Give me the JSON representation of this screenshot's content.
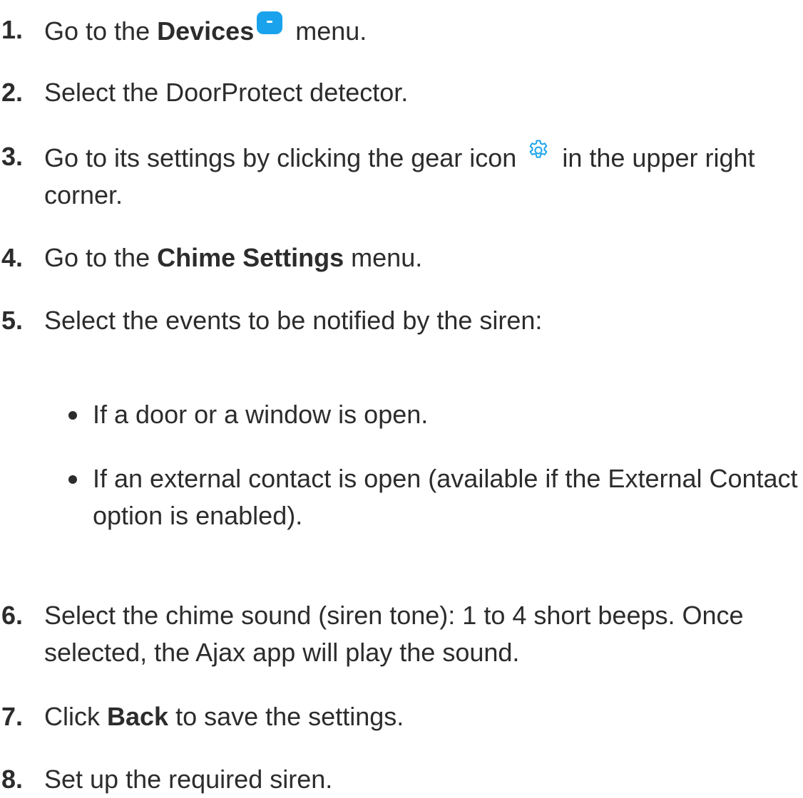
{
  "steps": [
    {
      "num": "1.",
      "pre": "Go to the ",
      "bold": "Devices",
      "post": " menu.",
      "icon": "devices-icon"
    },
    {
      "num": "2.",
      "text": "Select the DoorProtect detector."
    },
    {
      "num": "3.",
      "pre": "Go to its settings by clicking the gear icon ",
      "post": " in the upper right corner.",
      "icon": "gear-icon"
    },
    {
      "num": "4.",
      "pre": "Go to the ",
      "bold": "Chime Settings",
      "post": " menu."
    },
    {
      "num": "5.",
      "text": "Select the events to be notified by the siren:"
    },
    {
      "num": "6.",
      "text": "Select the chime sound (siren tone): 1 to 4 short beeps. Once selected, the Ajax app will play the sound."
    },
    {
      "num": "7.",
      "pre": "Click ",
      "bold": "Back",
      "post": " to save the settings."
    },
    {
      "num": "8.",
      "text": "Set up the required siren."
    }
  ],
  "bullets": [
    "If a door or a window is open.",
    "If an external contact is open (available if the External Contact option is enabled)."
  ],
  "colors": {
    "accent": "#1aa3ec",
    "text": "#2c2c2c"
  }
}
